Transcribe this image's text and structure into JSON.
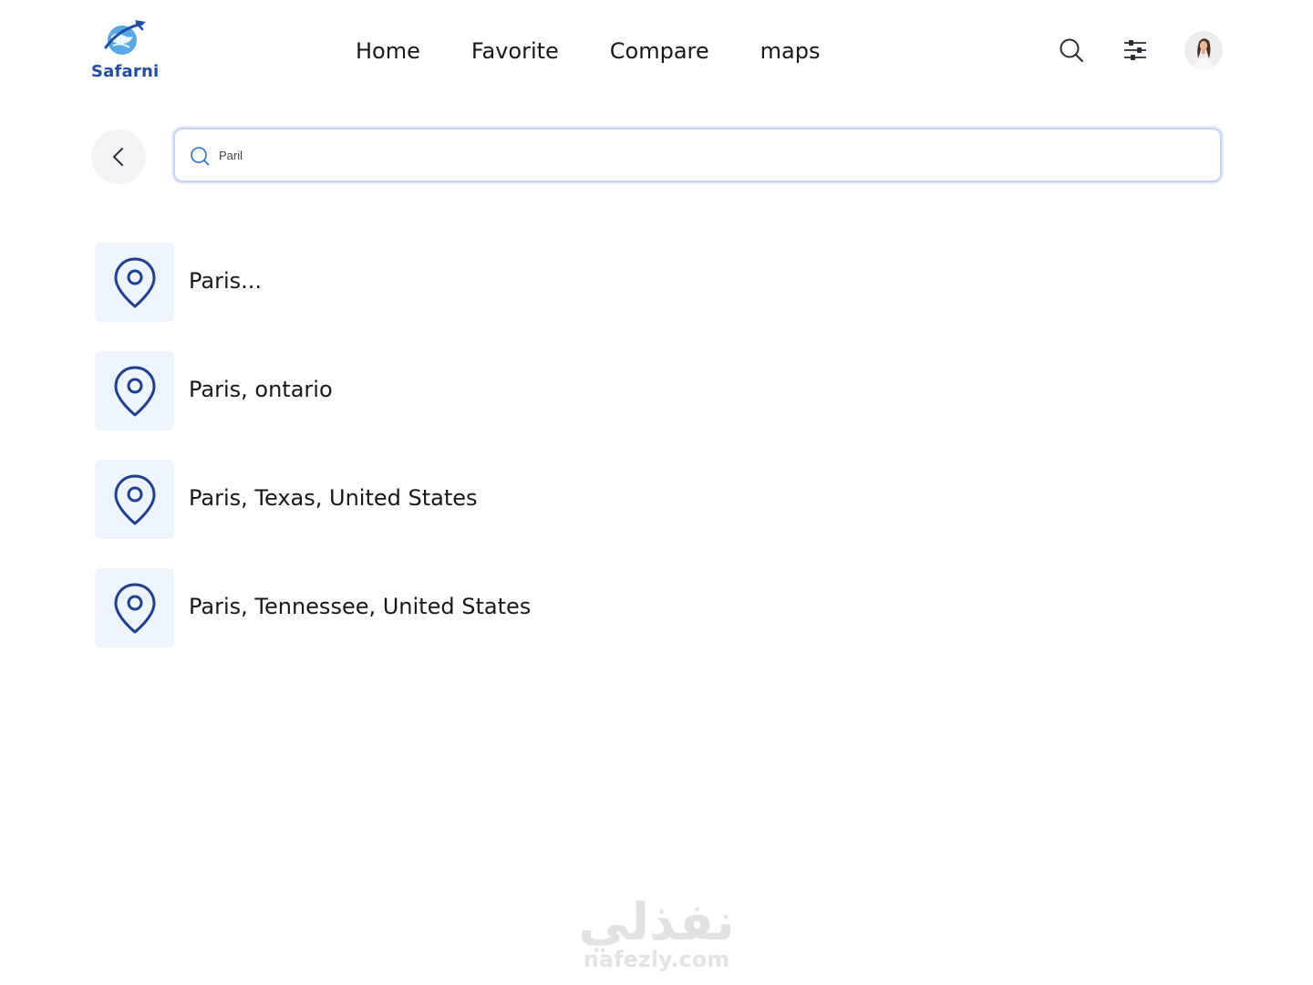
{
  "app": {
    "brand_name": "Safarni",
    "brand_color": "#1f4ea3"
  },
  "nav": {
    "items": [
      {
        "label": "Home"
      },
      {
        "label": "Favorite"
      },
      {
        "label": "Compare"
      },
      {
        "label": "maps"
      }
    ]
  },
  "header": {
    "search_icon": "search-icon",
    "filter_icon": "sliders-icon",
    "avatar_icon": "user-avatar"
  },
  "search": {
    "value": "Paril",
    "icon": "search-icon",
    "back_icon": "chevron-left-icon"
  },
  "results": {
    "icon": "map-pin-icon",
    "items": [
      {
        "label": "Paris..."
      },
      {
        "label": "Paris, ontario"
      },
      {
        "label": "Paris, Texas, United States"
      },
      {
        "label": "Paris, Tennessee, United States"
      }
    ]
  },
  "watermark": {
    "arabic": "نفذلي",
    "latin": "nafezly.com"
  },
  "colors": {
    "pin": "#1f3f8f",
    "tile": "#eef4fc",
    "search_border": "#c6d4ee",
    "search_icon": "#2a6fd6"
  }
}
